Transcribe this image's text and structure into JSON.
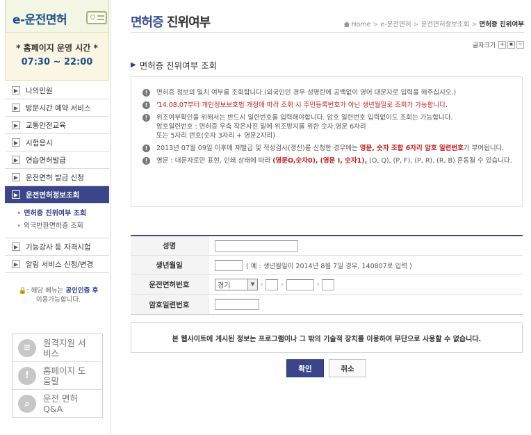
{
  "sidebar": {
    "logo": "e-운전면허",
    "hours_title": "* 홈페이지 운영 시간 *",
    "hours_time": "07:30 ~ 22:00",
    "menu_top": [
      {
        "label": "나의민원"
      },
      {
        "label": "방문시간 예약 서비스"
      },
      {
        "label": "교통안전교육"
      },
      {
        "label": "시험응시"
      },
      {
        "label": "연습면허발급"
      },
      {
        "label": "운전면허 발급 신청"
      },
      {
        "label": "운전면허정보조회"
      }
    ],
    "submenu": [
      {
        "label": "면허증 진위여부 조회"
      },
      {
        "label": "외국반환면허증 조회"
      }
    ],
    "menu_bottom": [
      {
        "label": "기능강사 등 자격시험"
      },
      {
        "label": "알림 서비스 신청/변경"
      }
    ],
    "login_note_prefix": ": 해당 메뉴는 ",
    "login_note_highlight": "공인인증 후",
    "login_note_suffix": "이용가능합니다.",
    "quick_links": [
      {
        "label": "원격지원 서비스",
        "icon": "wifi-icon"
      },
      {
        "label": "홈페이지 도움말",
        "icon": "alert-icon"
      },
      {
        "label": "운전 면허 Q&A",
        "icon": "search-icon"
      }
    ]
  },
  "header": {
    "title_part1": "면허증",
    "title_part2": " 진위여부",
    "breadcrumb": [
      "Home",
      "e-운전면허",
      "운전면허정보조회",
      "면허증 진위여부"
    ],
    "font_size_label": "글자크기",
    "font_buttons": [
      "+",
      "■",
      "−"
    ]
  },
  "section_title": "면허증 진위여부 조회",
  "notices": {
    "n1": "면허증 정보의 일치 여부를 조회합니다.(외국인인 경우 성명란에 공백없이 영어 대문자로 입력을 해주십시오.)",
    "n2": "'14.08.07부터 개인정보보호법 개정에 따라 조회 시 주민등록번호가 아닌 생년월일로 조회가 가능합니다.",
    "n3_line1": "위조여부확인을 위해서는 반드시 일련번호를 입력해야합니다. 암호 일련번호 입력없이도 조회는 가능합니다.",
    "n3_line2": "암호일련번호 : 면허증 우측 작은사진 밑에 위조방지를 위한 숫자.영문 6자리",
    "n3_line3": "또는 5자리 번호(숫자 3자리 + 영문2자리)",
    "n4_pre": "2013년 07월 09일 이후에 재발급 및 적성검사(갱신)를 신청한 경우에는 ",
    "n4_strong": "영문, 숫자 조합 6자리 암호 일련번호",
    "n4_post": "가 부여됩니다.",
    "n5_pre": "영문 : 대문자로만 표현, 인쇄 상태에 따라 ",
    "n5_strong1": "(영문O,숫자0),",
    "n5_strong2": "(영문 I, 숫자1),",
    "n5_post": " (O, Q), (P, F), (P, R), (R, B) 혼동될 수 있습니다."
  },
  "form": {
    "name_label": "성명",
    "name_value": "",
    "birth_label": "생년월일",
    "birth_value": "",
    "birth_hint": "( 예 : 생년월일이 2014년 8월 7일 경우, 140807로 입력 )",
    "license_label": "운전면허번호",
    "region_value": "경기",
    "license_parts": [
      "",
      "",
      ""
    ],
    "serial_label": "암호일련번호",
    "serial_value": ""
  },
  "warning": "본 웹사이트에 게시된 정보는 프로그램이나 그 밖의 기술적 장치를 이용하여 무단으로 사용할 수 없습니다.",
  "buttons": {
    "ok": "확인",
    "cancel": "취소"
  },
  "colors": {
    "primary": "#3b468a",
    "title_blue": "#3b4c9a",
    "notice_red": "#c62121"
  }
}
